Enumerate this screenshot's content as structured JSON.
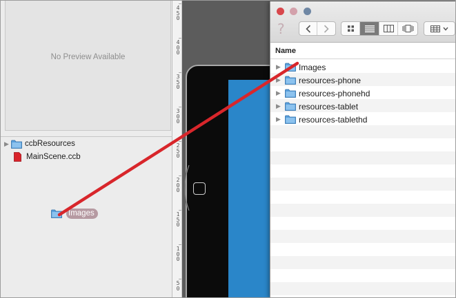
{
  "preview": {
    "placeholder": "No Preview Available"
  },
  "project_tree": {
    "items": [
      {
        "label": "ccbResources",
        "kind": "folder",
        "expandable": true
      },
      {
        "label": "MainScene.ccb",
        "kind": "ccb-file",
        "expandable": false
      }
    ]
  },
  "drag": {
    "label": "Images",
    "icon": "folder-icon"
  },
  "ruler": {
    "marks": [
      "450",
      "400",
      "350",
      "300",
      "250",
      "200",
      "150",
      "100",
      "50"
    ]
  },
  "finder": {
    "column_header": "Name",
    "items": [
      {
        "label": "Images"
      },
      {
        "label": "resources-phone"
      },
      {
        "label": "resources-phonehd"
      },
      {
        "label": "resources-tablet"
      },
      {
        "label": "resources-tablethd"
      }
    ]
  },
  "colors": {
    "folder_blue": "#5aa0dc",
    "scene_blue": "#2a86c9",
    "drag_line": "#d8262b",
    "ccb_file_red": "#d9232a"
  }
}
